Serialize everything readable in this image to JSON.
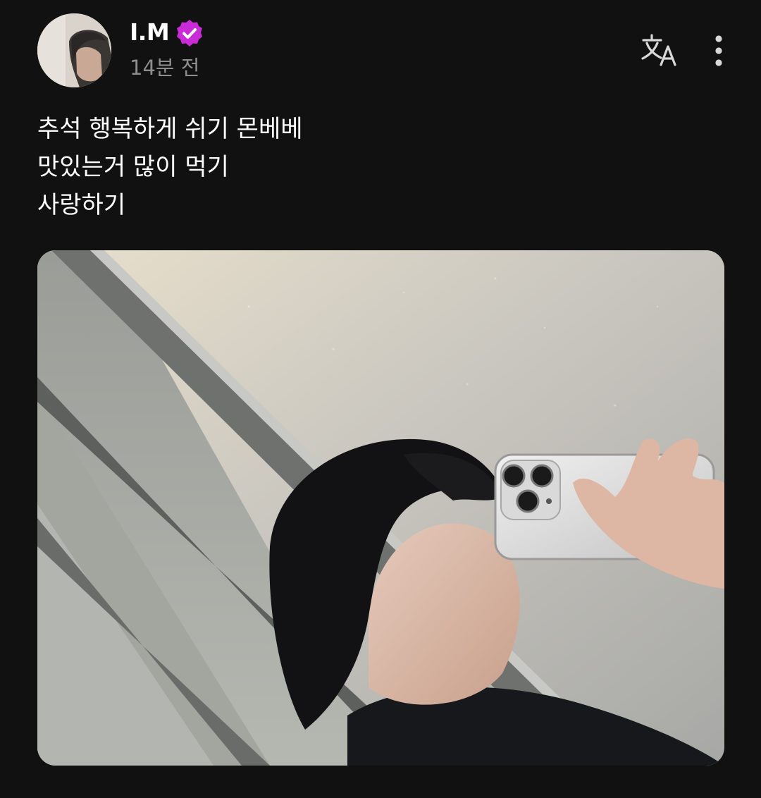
{
  "post": {
    "author": {
      "name": "I.M",
      "verified": true,
      "avatar_icon": "user-avatar-photo"
    },
    "timestamp": "14분 전",
    "actions": {
      "translate_icon": "translate-icon",
      "more_icon": "more-vertical-icon"
    },
    "caption": [
      "추석 행복하게 쉬기 몬베베",
      "맛있는거 많이 먹기",
      "사랑하기"
    ],
    "media": {
      "type": "photo",
      "description_icon": "mirror-selfie-photo"
    }
  },
  "colors": {
    "background": "#111111",
    "text": "#ffffff",
    "muted_text": "#8e8e8e",
    "verified_badge": "#c92bd6"
  }
}
